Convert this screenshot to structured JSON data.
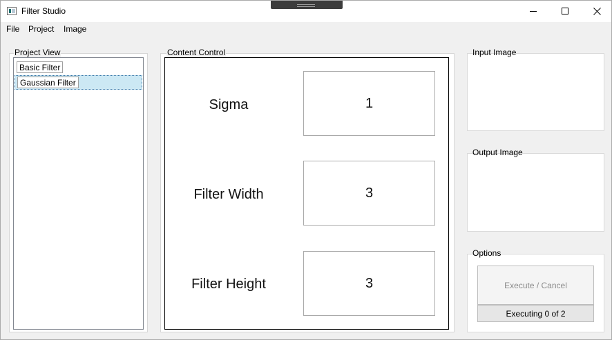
{
  "window": {
    "title": "Filter Studio"
  },
  "menu": {
    "items": [
      "File",
      "Project",
      "Image"
    ]
  },
  "project_view": {
    "label": "Project View",
    "items": [
      {
        "label": "Basic Filter",
        "selected": false
      },
      {
        "label": "Gaussian Filter",
        "selected": true
      }
    ]
  },
  "content_control": {
    "label": "Content Control",
    "params": [
      {
        "label": "Sigma",
        "value": "1"
      },
      {
        "label": "Filter Width",
        "value": "3"
      },
      {
        "label": "Filter Height",
        "value": "3"
      }
    ]
  },
  "input_image": {
    "label": "Input Image"
  },
  "output_image": {
    "label": "Output Image"
  },
  "options": {
    "label": "Options",
    "execute_label": "Execute / Cancel",
    "progress_text": "Executing 0 of 2"
  },
  "icons": {
    "app": "app-window-icon",
    "minimize": "minimize-icon",
    "maximize": "maximize-icon",
    "close": "close-icon"
  },
  "colors": {
    "selection": "#cce8f4",
    "selection_border": "#3a78a8",
    "disabled_text": "#8a8a8a"
  }
}
